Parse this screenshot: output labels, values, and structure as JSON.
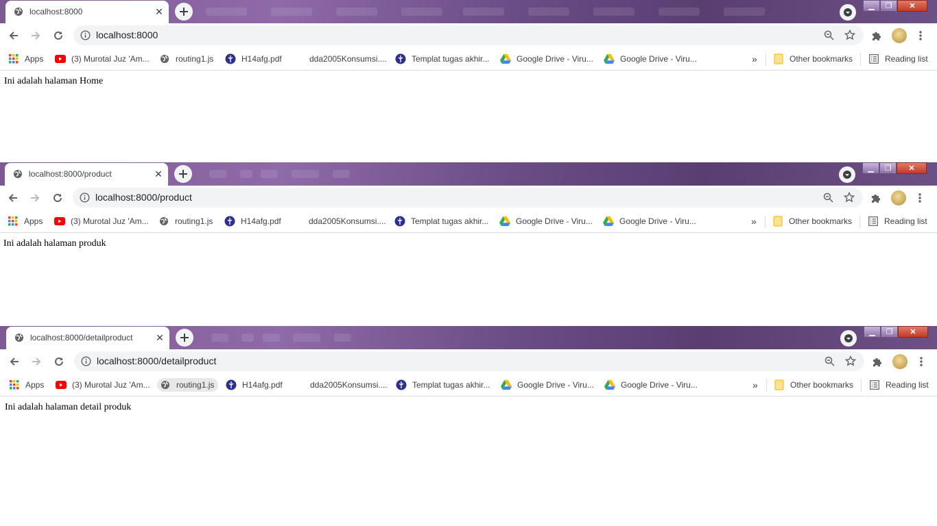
{
  "windows": [
    {
      "tab_title": "localhost:8000",
      "url": "localhost:8000",
      "content_text": "Ini adalah halaman Home"
    },
    {
      "tab_title": "localhost:8000/product",
      "url": "localhost:8000/product",
      "content_text": "Ini adalah halaman produk"
    },
    {
      "tab_title": "localhost:8000/detailproduct",
      "url": "localhost:8000/detailproduct",
      "content_text": "Ini adalah halaman detail produk"
    }
  ],
  "bookmarks": {
    "apps": "Apps",
    "items": [
      {
        "label": "(3) Murotal Juz 'Am...",
        "icon": "youtube-icon"
      },
      {
        "label": "routing1.js",
        "icon": "globe-icon"
      },
      {
        "label": "H14afg.pdf",
        "icon": "university-logo-icon"
      },
      {
        "label": "dda2005Konsumsi....",
        "icon": "blank-icon"
      },
      {
        "label": "Templat tugas akhir...",
        "icon": "university-logo-icon"
      },
      {
        "label": "Google Drive - Viru...",
        "icon": "google-drive-icon"
      },
      {
        "label": "Google Drive - Viru...",
        "icon": "google-drive-icon"
      }
    ],
    "overflow": "»",
    "other": "Other bookmarks",
    "reading_list": "Reading list"
  },
  "colors": {
    "frame_purple": "#7d5a94",
    "close_red": "#c43a26",
    "youtube_red": "#ff0000",
    "uni_blue": "#2e2e8f"
  }
}
